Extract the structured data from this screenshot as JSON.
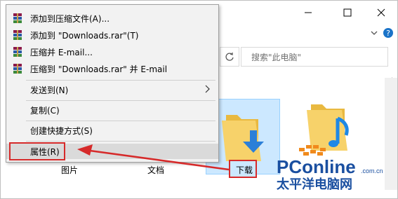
{
  "window": {
    "minimize_icon": "minimize-icon",
    "maximize_icon": "maximize-icon",
    "close_icon": "close-icon",
    "chevron_icon": "chevron-down-icon",
    "help_icon": "help-icon"
  },
  "address": {
    "search_placeholder": "搜索\"此电脑\""
  },
  "context_menu": {
    "items": [
      {
        "label": "添加到压缩文件(A)...",
        "icon": "winrar-icon"
      },
      {
        "label": "添加到 \"Downloads.rar\"(T)",
        "icon": "winrar-icon"
      },
      {
        "label": "压缩并 E-mail...",
        "icon": "winrar-icon"
      },
      {
        "label": "压缩到 \"Downloads.rar\" 并 E-mail",
        "icon": "winrar-icon"
      },
      {
        "label": "发送到(N)"
      },
      {
        "label": "复制(C)"
      },
      {
        "label": "创建快捷方式(S)"
      },
      {
        "label": "属性(R)"
      }
    ]
  },
  "folders": [
    {
      "label": "图片"
    },
    {
      "label": "文档"
    },
    {
      "label": "下载"
    }
  ],
  "colors": {
    "highlight_box": "#d62a2a",
    "selection": "#cce8ff",
    "folder": "#f7d26a",
    "download_arrow": "#2b7fd8",
    "music_note": "#1e88e5",
    "watermark_blue": "#1a4fa0",
    "watermark_orange": "#f08a1c"
  },
  "watermark": {
    "brand": "PConline",
    "domain": ".com.cn",
    "tagline": "太平洋电脑网"
  }
}
